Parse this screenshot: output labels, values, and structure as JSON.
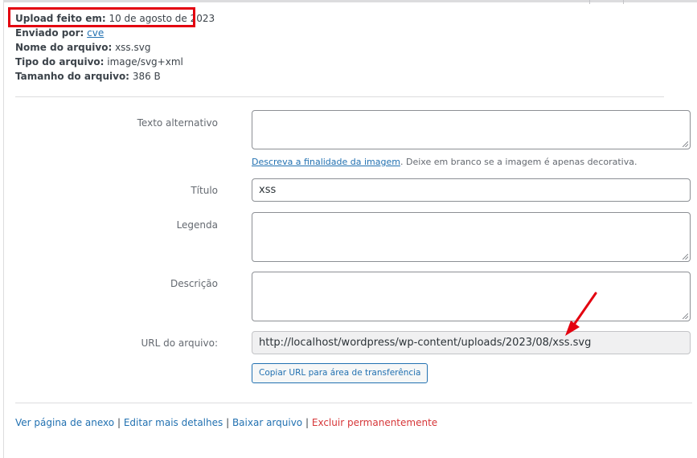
{
  "details": {
    "uploaded_label": "Upload feito em:",
    "uploaded_value": "10 de agosto de 2023",
    "sent_by_label": "Enviado por:",
    "sent_by_value": "cve",
    "file_name_label": "Nome do arquivo:",
    "file_name_value": "xss.svg",
    "file_type_label": "Tipo do arquivo:",
    "file_type_value": "image/svg+xml",
    "file_size_label": "Tamanho do arquivo:",
    "file_size_value": "386 B"
  },
  "form": {
    "alt_text_label": "Texto alternativo",
    "alt_text_value": "",
    "help_link": "Descreva a finalidade da imagem",
    "help_text": ". Deixe em branco se a imagem é apenas decorativa.",
    "title_label": "Título",
    "title_value": "xss",
    "caption_label": "Legenda",
    "caption_value": "",
    "description_label": "Descrição",
    "description_value": "",
    "url_label": "URL do arquivo:",
    "url_value": "http://localhost/wordpress/wp-content/uploads/2023/08/xss.svg",
    "copy_button": "Copiar URL para área de transferência"
  },
  "actions": {
    "view_attachment": "Ver página de anexo",
    "edit_details": "Editar mais detalhes",
    "download": "Baixar arquivo",
    "delete": "Excluir permanentemente",
    "separator": "|"
  },
  "colors": {
    "highlight": "#e3000f",
    "link": "#2271b1",
    "danger": "#d63638"
  }
}
